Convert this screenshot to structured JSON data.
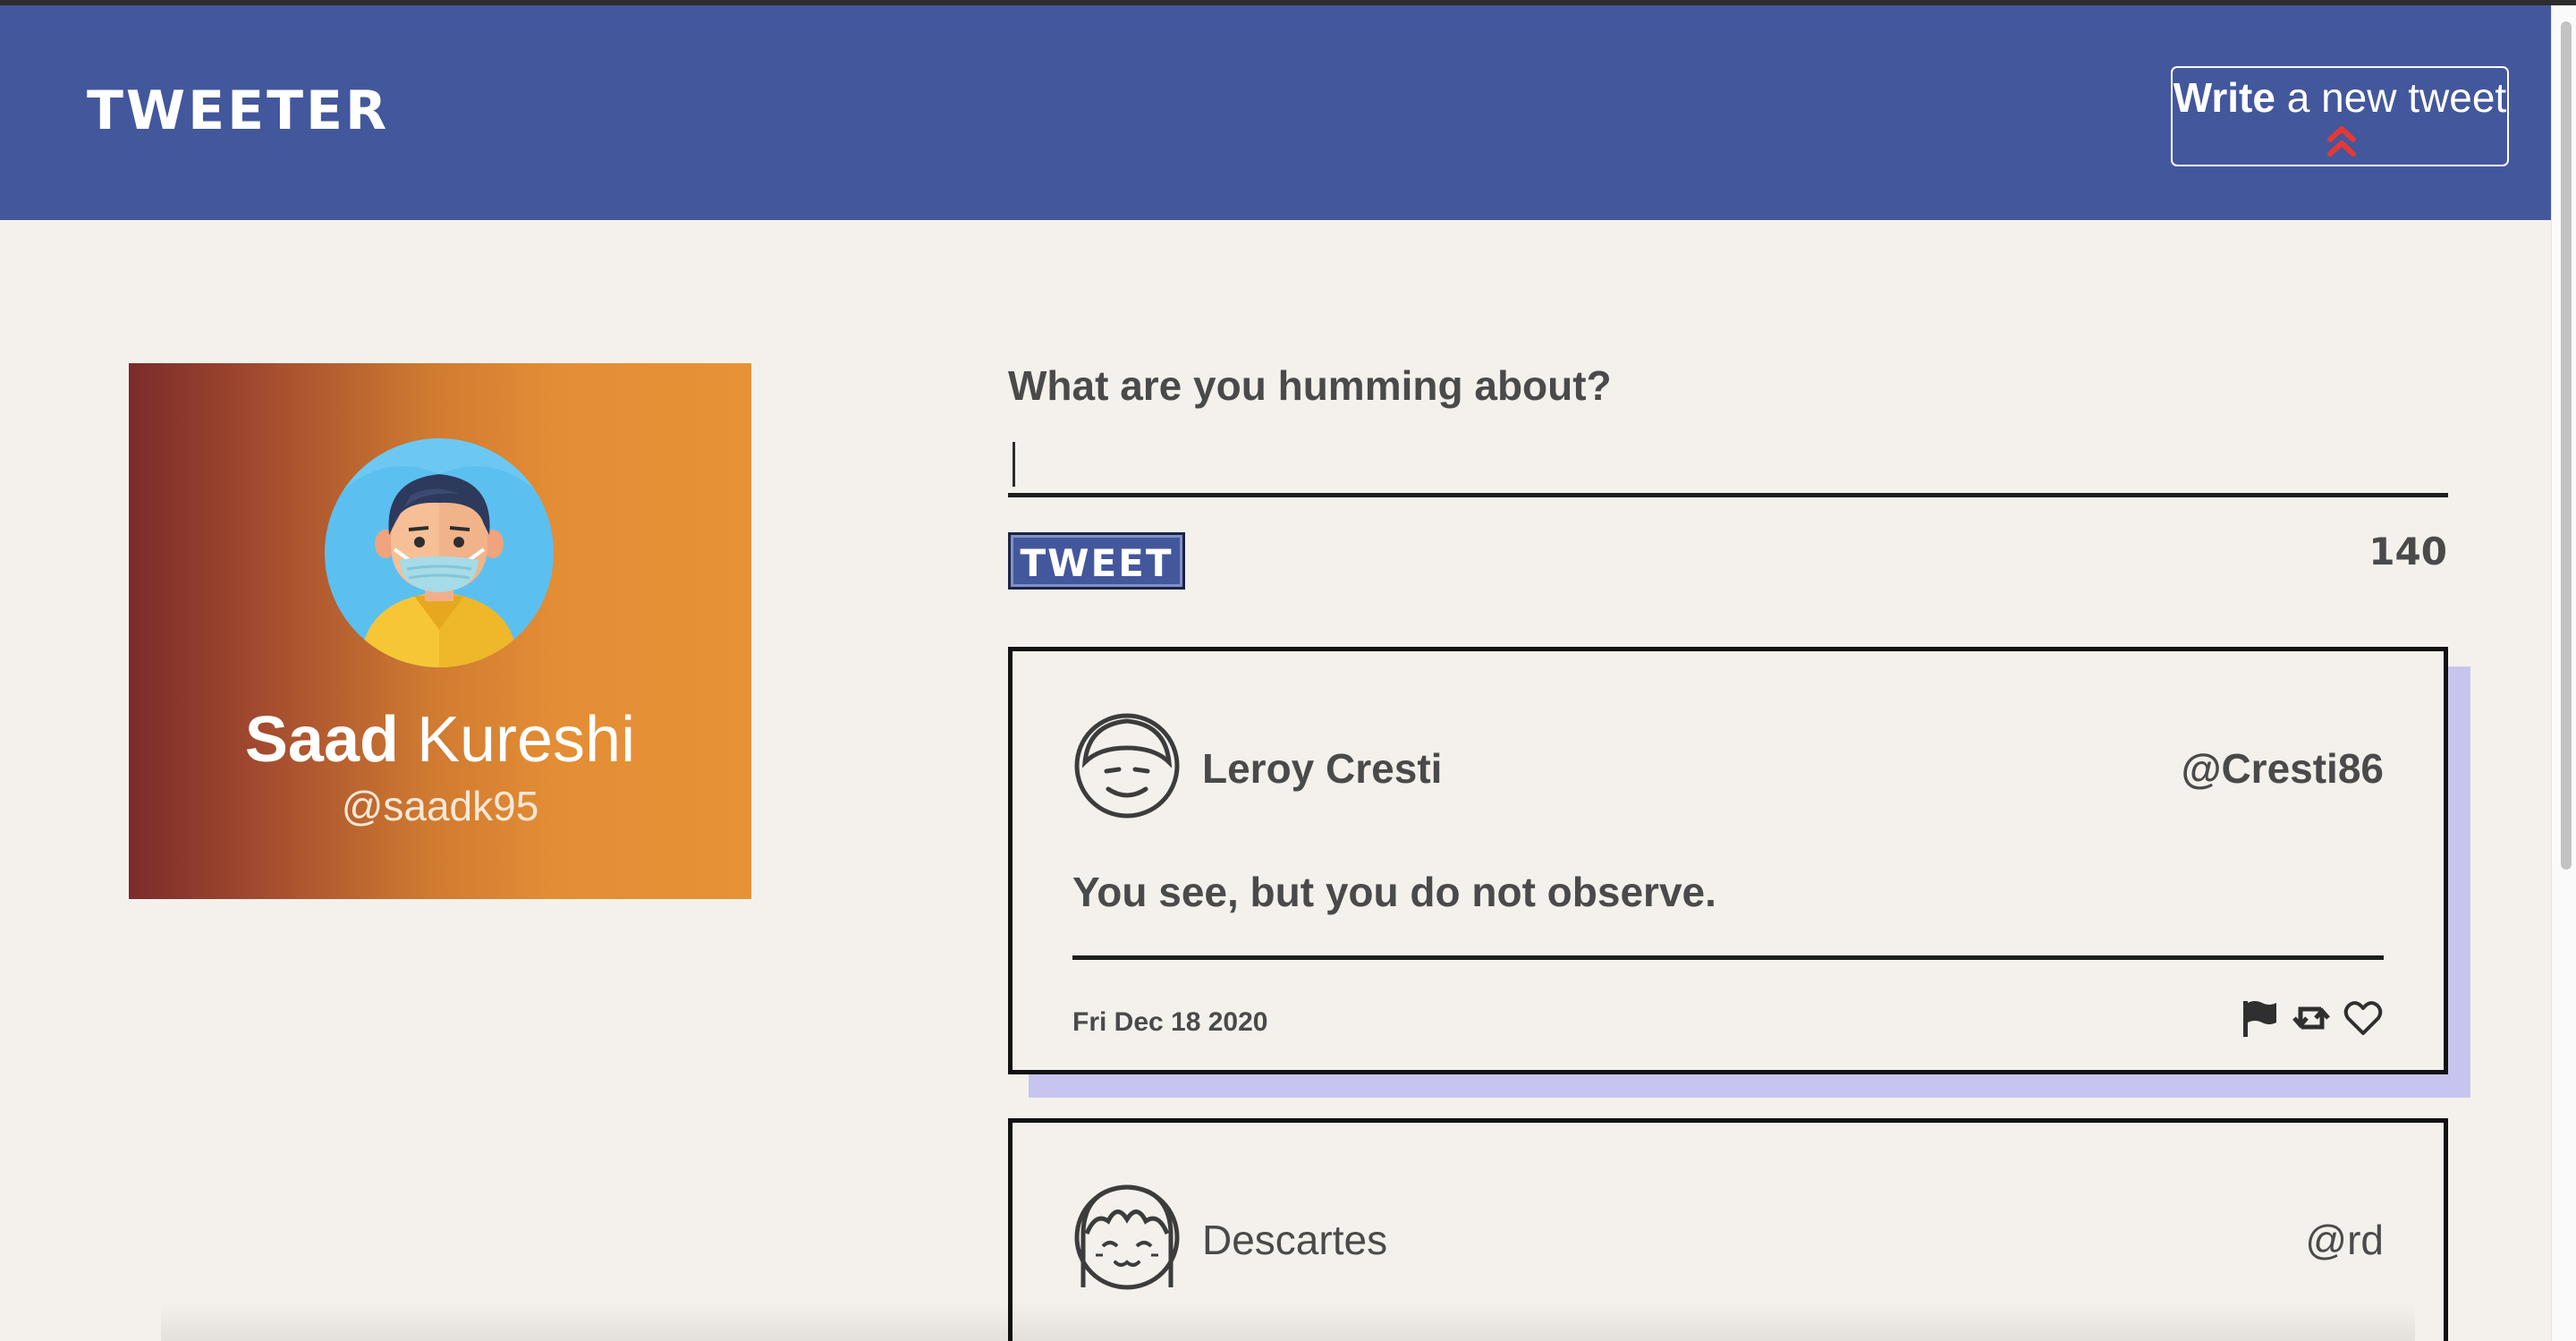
{
  "nav": {
    "brand": "TWEETER",
    "compose_bold": "Write",
    "compose_rest": " a new tweet",
    "compose_icon": "double-chevron-up-icon",
    "background": "#43579c",
    "accent": "#e53935"
  },
  "profile": {
    "first_name": "Saad",
    "last_name": " Kureshi",
    "handle": "@saadk95",
    "avatar_icon": "masked-man-avatar-icon"
  },
  "composer": {
    "prompt": "What are you humming about?",
    "input_value": "",
    "button_label": "TWEET",
    "char_count": "140"
  },
  "tweets": [
    {
      "author": "Leroy Cresti",
      "handle": "@Cresti86",
      "content": "You see, but you do not observe.",
      "date": "Fri Dec 18 2020",
      "avatar_icon": "smiling-man-outline-icon",
      "actions": [
        "flag-icon",
        "retweet-icon",
        "heart-icon"
      ]
    },
    {
      "author": "Descartes",
      "handle": "@rd",
      "avatar_icon": "girl-bangs-outline-icon"
    }
  ]
}
